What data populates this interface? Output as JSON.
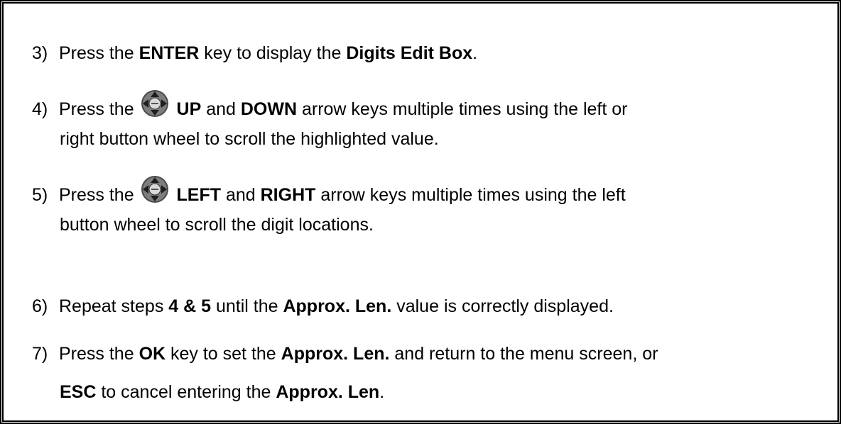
{
  "steps": [
    {
      "number": "3)",
      "segments": [
        "Press the ",
        "ENTER",
        " key to display the ",
        "Digits Edit Box",
        "."
      ]
    },
    {
      "number": "4)",
      "prefix": "Press the ",
      "icon": "directional-pad-icon",
      "line1": [
        " ",
        "UP",
        " and ",
        "DOWN",
        " arrow keys multiple times using the left or"
      ],
      "line2": "right button wheel to scroll the highlighted value."
    },
    {
      "number": "5)",
      "prefix": "Press the ",
      "icon": "directional-pad-icon",
      "line1": [
        " ",
        "LEFT",
        " and ",
        "RIGHT",
        " arrow keys multiple times using the left"
      ],
      "line2": "button wheel to scroll the digit locations."
    },
    {
      "number": "6)",
      "segments": [
        "Repeat steps ",
        "4 & 5",
        " until the ",
        "Approx. Len.",
        " value is correctly displayed."
      ]
    },
    {
      "number": "7)",
      "line1": [
        "Press the ",
        "OK",
        " key to set the ",
        "Approx. Len.",
        " and return to the menu screen, or"
      ],
      "line2": [
        "ESC",
        " to cancel entering the ",
        "Approx. Len",
        "."
      ]
    }
  ]
}
